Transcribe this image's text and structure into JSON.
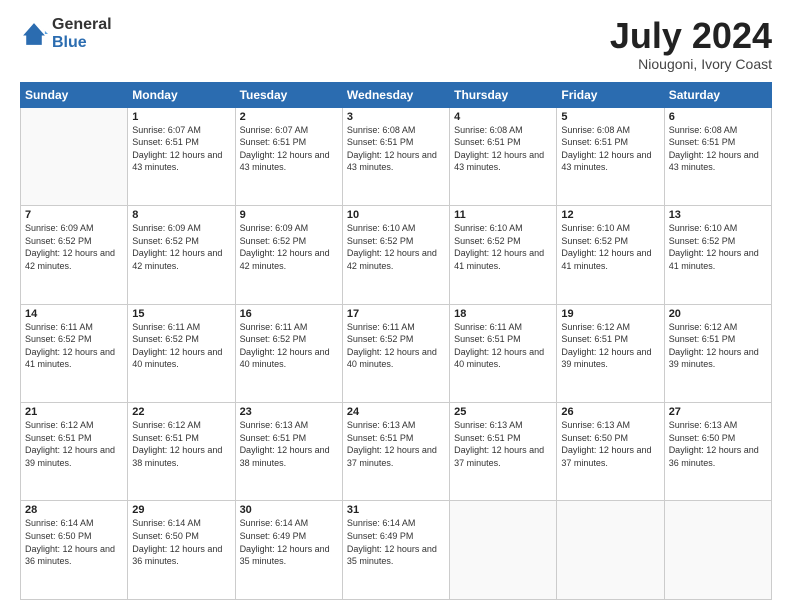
{
  "header": {
    "logo_general": "General",
    "logo_blue": "Blue",
    "month": "July 2024",
    "location": "Niougoni, Ivory Coast"
  },
  "days_of_week": [
    "Sunday",
    "Monday",
    "Tuesday",
    "Wednesday",
    "Thursday",
    "Friday",
    "Saturday"
  ],
  "weeks": [
    [
      {
        "day": "",
        "sunrise": "",
        "sunset": "",
        "daylight": ""
      },
      {
        "day": "1",
        "sunrise": "Sunrise: 6:07 AM",
        "sunset": "Sunset: 6:51 PM",
        "daylight": "Daylight: 12 hours and 43 minutes."
      },
      {
        "day": "2",
        "sunrise": "Sunrise: 6:07 AM",
        "sunset": "Sunset: 6:51 PM",
        "daylight": "Daylight: 12 hours and 43 minutes."
      },
      {
        "day": "3",
        "sunrise": "Sunrise: 6:08 AM",
        "sunset": "Sunset: 6:51 PM",
        "daylight": "Daylight: 12 hours and 43 minutes."
      },
      {
        "day": "4",
        "sunrise": "Sunrise: 6:08 AM",
        "sunset": "Sunset: 6:51 PM",
        "daylight": "Daylight: 12 hours and 43 minutes."
      },
      {
        "day": "5",
        "sunrise": "Sunrise: 6:08 AM",
        "sunset": "Sunset: 6:51 PM",
        "daylight": "Daylight: 12 hours and 43 minutes."
      },
      {
        "day": "6",
        "sunrise": "Sunrise: 6:08 AM",
        "sunset": "Sunset: 6:51 PM",
        "daylight": "Daylight: 12 hours and 43 minutes."
      }
    ],
    [
      {
        "day": "7",
        "sunrise": "Sunrise: 6:09 AM",
        "sunset": "Sunset: 6:52 PM",
        "daylight": "Daylight: 12 hours and 42 minutes."
      },
      {
        "day": "8",
        "sunrise": "Sunrise: 6:09 AM",
        "sunset": "Sunset: 6:52 PM",
        "daylight": "Daylight: 12 hours and 42 minutes."
      },
      {
        "day": "9",
        "sunrise": "Sunrise: 6:09 AM",
        "sunset": "Sunset: 6:52 PM",
        "daylight": "Daylight: 12 hours and 42 minutes."
      },
      {
        "day": "10",
        "sunrise": "Sunrise: 6:10 AM",
        "sunset": "Sunset: 6:52 PM",
        "daylight": "Daylight: 12 hours and 42 minutes."
      },
      {
        "day": "11",
        "sunrise": "Sunrise: 6:10 AM",
        "sunset": "Sunset: 6:52 PM",
        "daylight": "Daylight: 12 hours and 41 minutes."
      },
      {
        "day": "12",
        "sunrise": "Sunrise: 6:10 AM",
        "sunset": "Sunset: 6:52 PM",
        "daylight": "Daylight: 12 hours and 41 minutes."
      },
      {
        "day": "13",
        "sunrise": "Sunrise: 6:10 AM",
        "sunset": "Sunset: 6:52 PM",
        "daylight": "Daylight: 12 hours and 41 minutes."
      }
    ],
    [
      {
        "day": "14",
        "sunrise": "Sunrise: 6:11 AM",
        "sunset": "Sunset: 6:52 PM",
        "daylight": "Daylight: 12 hours and 41 minutes."
      },
      {
        "day": "15",
        "sunrise": "Sunrise: 6:11 AM",
        "sunset": "Sunset: 6:52 PM",
        "daylight": "Daylight: 12 hours and 40 minutes."
      },
      {
        "day": "16",
        "sunrise": "Sunrise: 6:11 AM",
        "sunset": "Sunset: 6:52 PM",
        "daylight": "Daylight: 12 hours and 40 minutes."
      },
      {
        "day": "17",
        "sunrise": "Sunrise: 6:11 AM",
        "sunset": "Sunset: 6:52 PM",
        "daylight": "Daylight: 12 hours and 40 minutes."
      },
      {
        "day": "18",
        "sunrise": "Sunrise: 6:11 AM",
        "sunset": "Sunset: 6:51 PM",
        "daylight": "Daylight: 12 hours and 40 minutes."
      },
      {
        "day": "19",
        "sunrise": "Sunrise: 6:12 AM",
        "sunset": "Sunset: 6:51 PM",
        "daylight": "Daylight: 12 hours and 39 minutes."
      },
      {
        "day": "20",
        "sunrise": "Sunrise: 6:12 AM",
        "sunset": "Sunset: 6:51 PM",
        "daylight": "Daylight: 12 hours and 39 minutes."
      }
    ],
    [
      {
        "day": "21",
        "sunrise": "Sunrise: 6:12 AM",
        "sunset": "Sunset: 6:51 PM",
        "daylight": "Daylight: 12 hours and 39 minutes."
      },
      {
        "day": "22",
        "sunrise": "Sunrise: 6:12 AM",
        "sunset": "Sunset: 6:51 PM",
        "daylight": "Daylight: 12 hours and 38 minutes."
      },
      {
        "day": "23",
        "sunrise": "Sunrise: 6:13 AM",
        "sunset": "Sunset: 6:51 PM",
        "daylight": "Daylight: 12 hours and 38 minutes."
      },
      {
        "day": "24",
        "sunrise": "Sunrise: 6:13 AM",
        "sunset": "Sunset: 6:51 PM",
        "daylight": "Daylight: 12 hours and 37 minutes."
      },
      {
        "day": "25",
        "sunrise": "Sunrise: 6:13 AM",
        "sunset": "Sunset: 6:51 PM",
        "daylight": "Daylight: 12 hours and 37 minutes."
      },
      {
        "day": "26",
        "sunrise": "Sunrise: 6:13 AM",
        "sunset": "Sunset: 6:50 PM",
        "daylight": "Daylight: 12 hours and 37 minutes."
      },
      {
        "day": "27",
        "sunrise": "Sunrise: 6:13 AM",
        "sunset": "Sunset: 6:50 PM",
        "daylight": "Daylight: 12 hours and 36 minutes."
      }
    ],
    [
      {
        "day": "28",
        "sunrise": "Sunrise: 6:14 AM",
        "sunset": "Sunset: 6:50 PM",
        "daylight": "Daylight: 12 hours and 36 minutes."
      },
      {
        "day": "29",
        "sunrise": "Sunrise: 6:14 AM",
        "sunset": "Sunset: 6:50 PM",
        "daylight": "Daylight: 12 hours and 36 minutes."
      },
      {
        "day": "30",
        "sunrise": "Sunrise: 6:14 AM",
        "sunset": "Sunset: 6:49 PM",
        "daylight": "Daylight: 12 hours and 35 minutes."
      },
      {
        "day": "31",
        "sunrise": "Sunrise: 6:14 AM",
        "sunset": "Sunset: 6:49 PM",
        "daylight": "Daylight: 12 hours and 35 minutes."
      },
      {
        "day": "",
        "sunrise": "",
        "sunset": "",
        "daylight": ""
      },
      {
        "day": "",
        "sunrise": "",
        "sunset": "",
        "daylight": ""
      },
      {
        "day": "",
        "sunrise": "",
        "sunset": "",
        "daylight": ""
      }
    ]
  ]
}
